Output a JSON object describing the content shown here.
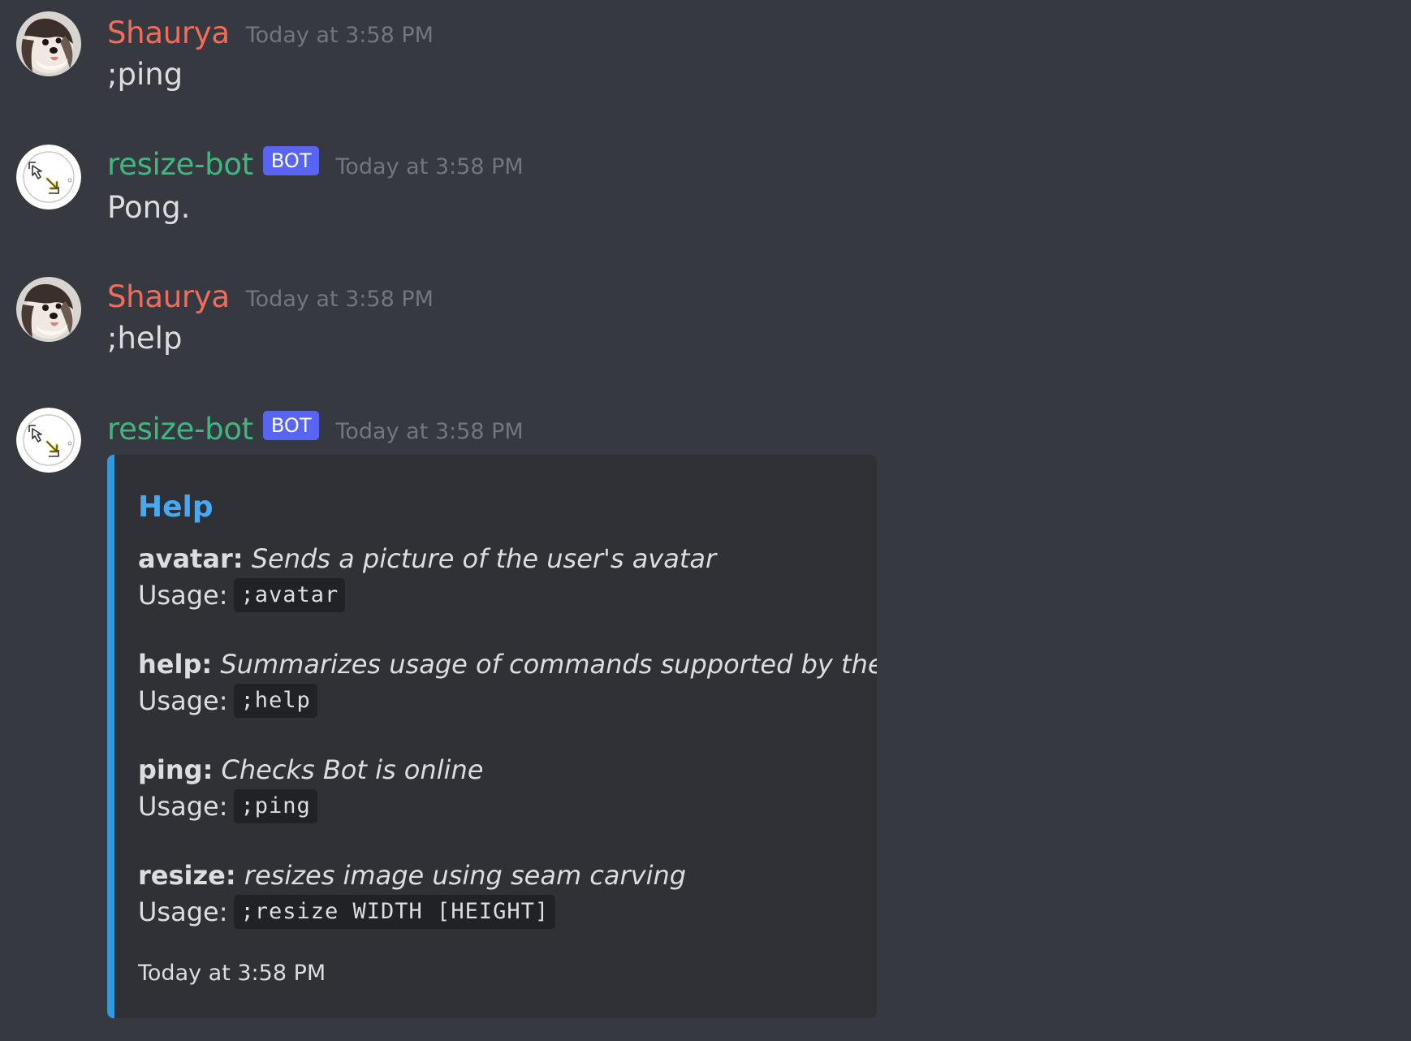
{
  "colors": {
    "background": "#36393f",
    "user_name": "#f26c5c",
    "bot_name": "#43b581",
    "bot_tag": "#5865f2",
    "embed_accent": "#3498db",
    "embed_title": "#4aa8ef"
  },
  "messages": [
    {
      "username": "Shaurya",
      "timestamp": "Today at 3:58 PM",
      "content": ";ping",
      "avatar_icon": "dog-photo-avatar"
    },
    {
      "username": "resize-bot",
      "bot_tag": "BOT",
      "timestamp": "Today at 3:58 PM",
      "content": "Pong.",
      "avatar_icon": "resize-arrows-avatar"
    },
    {
      "username": "Shaurya",
      "timestamp": "Today at 3:58 PM",
      "content": ";help",
      "avatar_icon": "dog-photo-avatar"
    },
    {
      "username": "resize-bot",
      "bot_tag": "BOT",
      "timestamp": "Today at 3:58 PM",
      "avatar_icon": "resize-arrows-avatar",
      "embed": {
        "title": "Help",
        "usage_label": "Usage:",
        "commands": [
          {
            "name": "avatar:",
            "description": "Sends a picture of the user's avatar",
            "usage": ";avatar"
          },
          {
            "name": "help:",
            "description": "Summarizes usage of commands supported by the bot",
            "usage": ";help"
          },
          {
            "name": "ping:",
            "description": "Checks Bot is online",
            "usage": ";ping"
          },
          {
            "name": "resize:",
            "description": "resizes image using seam carving",
            "usage": ";resize WIDTH [HEIGHT]"
          }
        ],
        "footer": "Today at 3:58 PM"
      }
    }
  ]
}
